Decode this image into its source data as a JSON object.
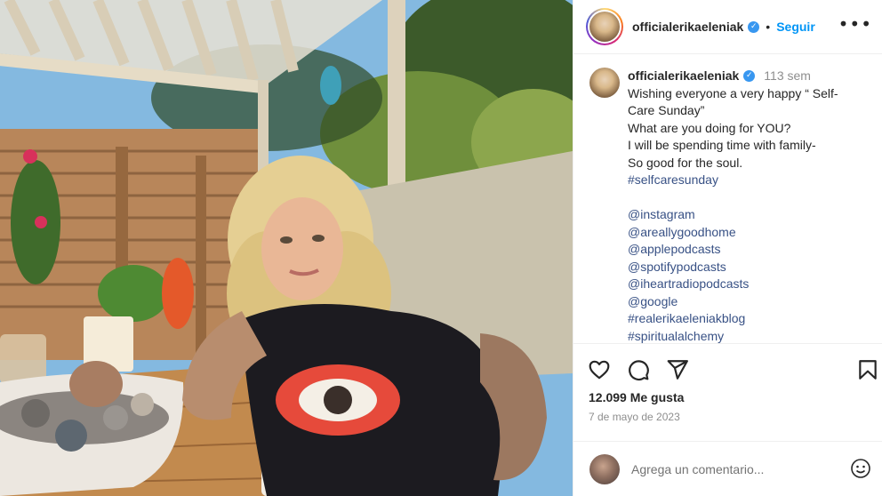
{
  "header": {
    "username": "officialerikaeleniak",
    "verified_icon": "verified-badge-icon",
    "separator": "•",
    "follow_label": "Seguir",
    "more_icon": "more-options-icon"
  },
  "caption": {
    "username": "officialerikaeleniak",
    "time": "113 sem",
    "lines": [
      "Wishing everyone a very happy “ Self-",
      "Care Sunday”",
      "What are you doing for YOU?",
      "I will be spending time with family-",
      "So good for the soul."
    ],
    "hashtag": "#selfcaresunday",
    "mentions": [
      "@instagram",
      "@areallygoodhome",
      "@applepodcasts",
      "@spotifypodcasts",
      "@iheartradiopodcasts",
      "@google",
      "#realerikaeleniakblog",
      "#spiritualalchemy"
    ]
  },
  "actions": {
    "like_icon": "heart-icon",
    "comment_icon": "comment-icon",
    "share_icon": "send-icon",
    "save_icon": "bookmark-icon",
    "likes": "12.099 Me gusta",
    "date": "7 de mayo de 2023"
  },
  "comment_box": {
    "placeholder": "Agrega un comentario...",
    "emoji_icon": "emoji-icon"
  },
  "colors": {
    "accent": "#0095f6",
    "link": "#385185",
    "muted": "#8e8e8e",
    "verified": "#3897f0"
  }
}
